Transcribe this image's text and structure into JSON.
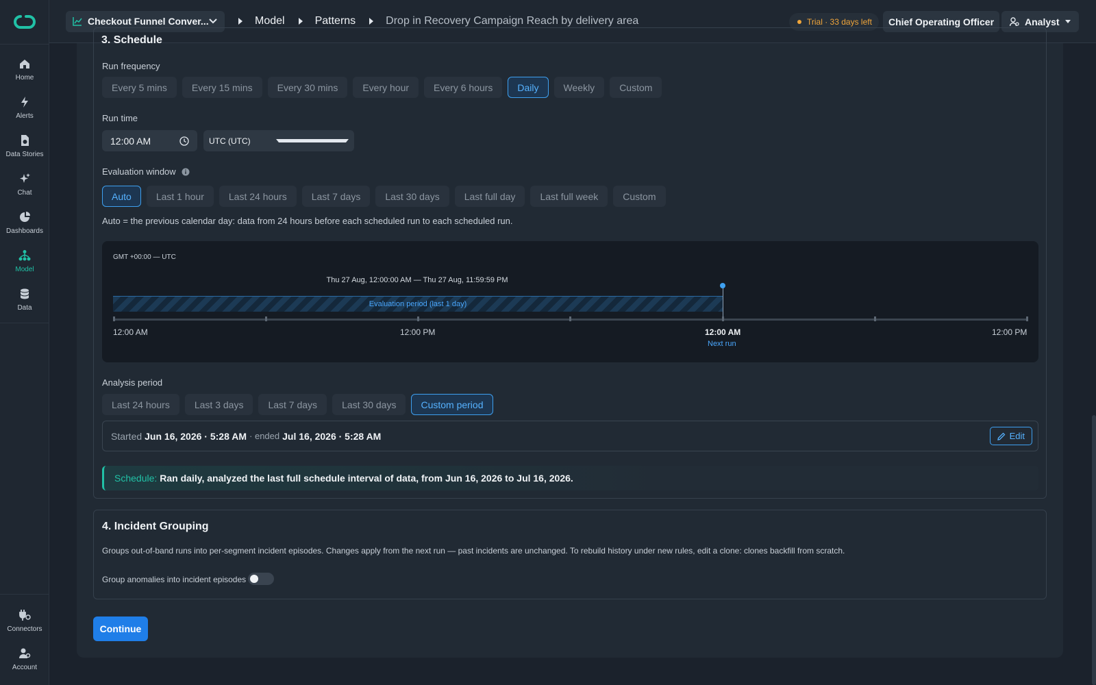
{
  "sidebar": {
    "items": [
      {
        "label": "Home",
        "icon": "home-icon"
      },
      {
        "label": "Alerts",
        "icon": "bolt-icon"
      },
      {
        "label": "Data Stories",
        "icon": "story-icon"
      },
      {
        "label": "Chat",
        "icon": "sparkle-icon"
      },
      {
        "label": "Dashboards",
        "icon": "pie-icon"
      },
      {
        "label": "Model",
        "icon": "model-icon",
        "active": true
      },
      {
        "label": "Data",
        "icon": "database-icon"
      }
    ],
    "bottom": [
      {
        "label": "Connectors",
        "icon": "plug-icon"
      },
      {
        "label": "Account",
        "icon": "account-icon"
      }
    ]
  },
  "topbar": {
    "dataset": "Checkout Funnel Conver...",
    "breadcrumbs": [
      "Model",
      "Patterns",
      "Drop in Recovery Campaign Reach by delivery area"
    ],
    "trial": "Trial · 33 days left",
    "role": "Chief Operating Officer",
    "user": "Analyst"
  },
  "schedule": {
    "section_title": "3. Schedule",
    "run_frequency_label": "Run frequency",
    "frequencies": [
      "Every 5 mins",
      "Every 15 mins",
      "Every 30 mins",
      "Every hour",
      "Every 6 hours",
      "Daily",
      "Weekly",
      "Custom"
    ],
    "frequency_selected": "Daily",
    "run_time_label": "Run time",
    "run_time": "12:00 AM",
    "timezone": "UTC (UTC)",
    "eval_label": "Evaluation window",
    "eval_options": [
      "Auto",
      "Last 1 hour",
      "Last 24 hours",
      "Last 7 days",
      "Last 30 days",
      "Last full day",
      "Last full week",
      "Custom"
    ],
    "eval_selected": "Auto",
    "auto_info": "Auto = the previous calendar day: data from 24 hours before each scheduled run to each scheduled run.",
    "timeline": {
      "tz": "GMT +00:00 — UTC",
      "range": "Thu 27 Aug, 12:00:00 AM — Thu 27 Aug, 11:59:59 PM",
      "band_label": "Evaluation period (last 1 day)",
      "axis_labels": [
        "12:00 AM",
        "12:00 PM",
        "12:00 AM",
        "12:00 PM"
      ],
      "next_run": "Next run"
    },
    "analysis_label": "Analysis period",
    "analysis_options": [
      "Last 24 hours",
      "Last 3 days",
      "Last 7 days",
      "Last 30 days",
      "Custom period"
    ],
    "analysis_selected": "Custom period",
    "period": {
      "started_word": "Started",
      "start": "Jun 16, 2026 · 5:28 AM",
      "ended_word": "· ended",
      "end": "Jul 16, 2026 · 5:28 AM",
      "edit": "Edit"
    },
    "summary_key": "Schedule:",
    "summary_text": "Ran daily, analyzed the last full schedule interval of data, from Jun 16, 2026 to Jul 16, 2026."
  },
  "incident": {
    "title": "4. Incident Grouping",
    "description": "Groups out-of-band runs into per-segment incident episodes. Changes apply from the next run — past incidents are unchanged. To rebuild history under new rules, edit a clone: clones backfill from scratch.",
    "toggle_label": "Group anomalies into incident episodes",
    "toggle_on": false
  },
  "continue": "Continue",
  "colors": {
    "accent": "#21c1a6",
    "primary": "#1f7ee8",
    "trial": "#f0a53a"
  }
}
